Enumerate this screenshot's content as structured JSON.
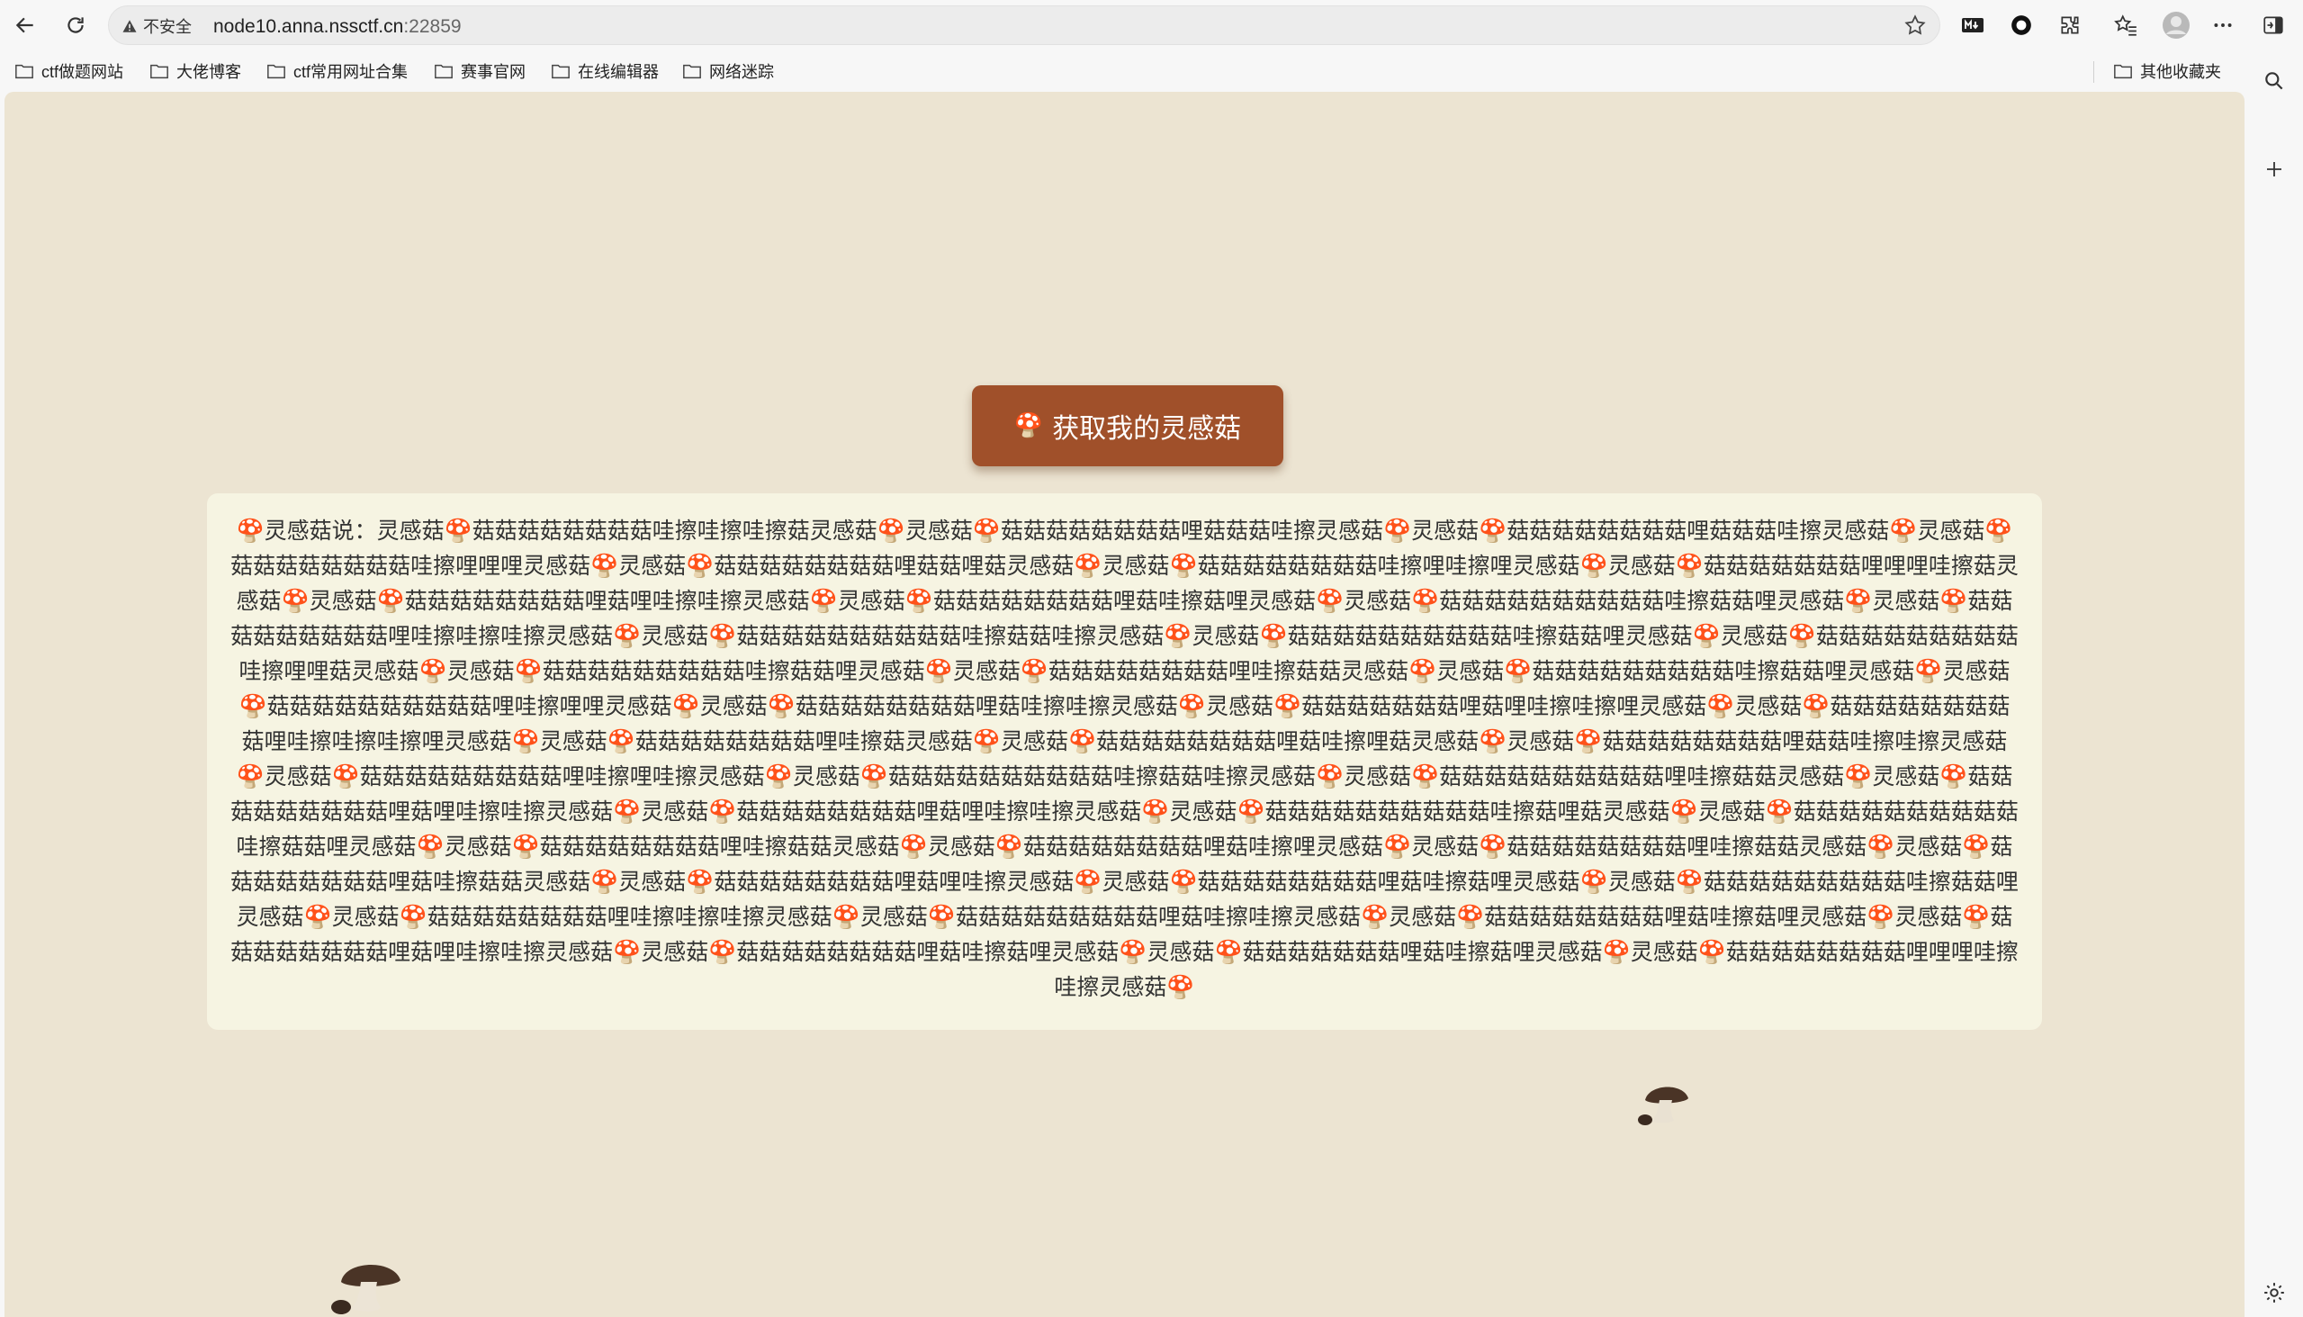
{
  "browser": {
    "security_label": "不安全",
    "url_host": "node10.anna.nssctf.cn",
    "url_port": ":22859",
    "icons": [
      "back-icon",
      "reload-icon",
      "warning-icon",
      "star-icon",
      "markdown-icon",
      "record-icon",
      "extension-icon",
      "favorites-icon",
      "profile-icon",
      "more-icon",
      "sidebar-icon",
      "search-icon",
      "plus-icon",
      "settings-icon"
    ]
  },
  "bookmarks": {
    "items": [
      {
        "label": "ctf做题网站"
      },
      {
        "label": "大佬博客"
      },
      {
        "label": "ctf常用网址合集"
      },
      {
        "label": "赛事官网"
      },
      {
        "label": "在线编辑器"
      },
      {
        "label": "网络迷踪"
      }
    ],
    "other": "其他收藏夹"
  },
  "page": {
    "button_label": "获取我的灵感菇",
    "message": "🍄灵感菇说：灵感菇🍄菇菇菇菇菇菇菇菇哇擦哇擦哇擦菇灵感菇🍄灵感菇🍄菇菇菇菇菇菇菇菇哩菇菇菇哇擦灵感菇🍄灵感菇🍄菇菇菇菇菇菇菇菇哩菇菇菇哇擦灵感菇🍄灵感菇🍄菇菇菇菇菇菇菇菇哇擦哩哩哩灵感菇🍄灵感菇🍄菇菇菇菇菇菇菇菇哩菇菇哩菇灵感菇🍄灵感菇🍄菇菇菇菇菇菇菇菇哇擦哩哇擦哩灵感菇🍄灵感菇🍄菇菇菇菇菇菇菇哩哩哩哇擦菇灵感菇🍄灵感菇🍄菇菇菇菇菇菇菇菇哩菇哩哇擦哇擦灵感菇🍄灵感菇🍄菇菇菇菇菇菇菇菇哩菇哇擦菇哩灵感菇🍄灵感菇🍄菇菇菇菇菇菇菇菇菇菇哇擦菇菇哩灵感菇🍄灵感菇🍄菇菇菇菇菇菇菇菇菇哩哇擦哇擦哇擦灵感菇🍄灵感菇🍄菇菇菇菇菇菇菇菇菇菇哇擦菇菇哇擦灵感菇🍄灵感菇🍄菇菇菇菇菇菇菇菇菇菇哇擦菇菇哩灵感菇🍄灵感菇🍄菇菇菇菇菇菇菇菇菇哇擦哩哩菇灵感菇🍄灵感菇🍄菇菇菇菇菇菇菇菇菇哇擦菇菇哩灵感菇🍄灵感菇🍄菇菇菇菇菇菇菇菇哩哇擦菇菇灵感菇🍄灵感菇🍄菇菇菇菇菇菇菇菇菇哇擦菇菇哩灵感菇🍄灵感菇🍄菇菇菇菇菇菇菇菇菇菇哩哇擦哩哩灵感菇🍄灵感菇🍄菇菇菇菇菇菇菇菇哩菇哇擦哇擦灵感菇🍄灵感菇🍄菇菇菇菇菇菇菇哩菇哩哇擦哇擦哩灵感菇🍄灵感菇🍄菇菇菇菇菇菇菇菇菇哩哇擦哇擦哇擦哩灵感菇🍄灵感菇🍄菇菇菇菇菇菇菇菇哩哇擦菇灵感菇🍄灵感菇🍄菇菇菇菇菇菇菇菇哩菇哇擦哩菇灵感菇🍄灵感菇🍄菇菇菇菇菇菇菇菇哩菇菇哇擦哇擦灵感菇🍄灵感菇🍄菇菇菇菇菇菇菇菇菇哩哇擦哩哇擦灵感菇🍄灵感菇🍄菇菇菇菇菇菇菇菇菇菇哇擦菇菇哇擦灵感菇🍄灵感菇🍄菇菇菇菇菇菇菇菇菇菇哩哇擦菇菇灵感菇🍄灵感菇🍄菇菇菇菇菇菇菇菇菇哩菇哩哇擦哇擦灵感菇🍄灵感菇🍄菇菇菇菇菇菇菇菇哩菇哩哇擦哇擦灵感菇🍄灵感菇🍄菇菇菇菇菇菇菇菇菇菇哇擦菇哩菇灵感菇🍄灵感菇🍄菇菇菇菇菇菇菇菇菇菇哇擦菇菇哩灵感菇🍄灵感菇🍄菇菇菇菇菇菇菇菇哩哇擦菇菇灵感菇🍄灵感菇🍄菇菇菇菇菇菇菇菇哩菇哇擦哩灵感菇🍄灵感菇🍄菇菇菇菇菇菇菇菇哩哇擦菇菇灵感菇🍄灵感菇🍄菇菇菇菇菇菇菇菇哩菇哇擦菇菇灵感菇🍄灵感菇🍄菇菇菇菇菇菇菇菇哩菇哩哇擦灵感菇🍄灵感菇🍄菇菇菇菇菇菇菇菇哩菇哇擦菇哩灵感菇🍄灵感菇🍄菇菇菇菇菇菇菇菇菇哇擦菇菇哩灵感菇🍄灵感菇🍄菇菇菇菇菇菇菇菇哩哇擦哇擦哇擦灵感菇🍄灵感菇🍄菇菇菇菇菇菇菇菇菇哩菇哇擦哇擦灵感菇🍄灵感菇🍄菇菇菇菇菇菇菇菇哩菇哇擦菇哩灵感菇🍄灵感菇🍄菇菇菇菇菇菇菇菇哩菇哩哇擦哇擦灵感菇🍄灵感菇🍄菇菇菇菇菇菇菇菇哩菇哇擦菇哩灵感菇🍄灵感菇🍄菇菇菇菇菇菇菇哩菇哇擦菇哩灵感菇🍄灵感菇🍄菇菇菇菇菇菇菇菇哩哩哩哇擦哇擦灵感菇🍄"
  },
  "colors": {
    "page_bg": "#ece4d2",
    "button_bg": "#a0502a",
    "box_bg": "#f6f4e2"
  }
}
